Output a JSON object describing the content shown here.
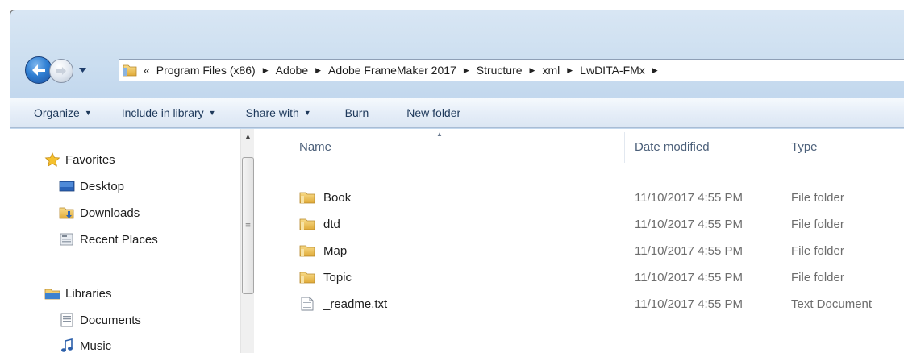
{
  "address": {
    "overflow": "«",
    "crumbs": [
      "Program Files (x86)",
      "Adobe",
      "Adobe FrameMaker 2017",
      "Structure",
      "xml",
      "LwDITA-FMx"
    ]
  },
  "toolbar": {
    "organize": "Organize",
    "include_in_library": "Include in library",
    "share_with": "Share with",
    "burn": "Burn",
    "new_folder": "New folder"
  },
  "nav": {
    "favorites": "Favorites",
    "desktop": "Desktop",
    "downloads": "Downloads",
    "recent_places": "Recent Places",
    "libraries": "Libraries",
    "documents": "Documents",
    "music": "Music"
  },
  "columns": {
    "name": "Name",
    "date_modified": "Date modified",
    "type": "Type"
  },
  "files": [
    {
      "name": "Book",
      "date": "11/10/2017 4:55 PM",
      "type": "File folder",
      "icon": "folder-icon"
    },
    {
      "name": "dtd",
      "date": "11/10/2017 4:55 PM",
      "type": "File folder",
      "icon": "folder-icon"
    },
    {
      "name": "Map",
      "date": "11/10/2017 4:55 PM",
      "type": "File folder",
      "icon": "folder-icon"
    },
    {
      "name": "Topic",
      "date": "11/10/2017 4:55 PM",
      "type": "File folder",
      "icon": "folder-icon"
    },
    {
      "name": "_readme.txt",
      "date": "11/10/2017 4:55 PM",
      "type": "Text Document",
      "icon": "text-file-icon"
    }
  ],
  "colors": {
    "folder": "#e8b84a",
    "title_bar": "#cddff0",
    "toolbar_text": "#1e395b"
  }
}
